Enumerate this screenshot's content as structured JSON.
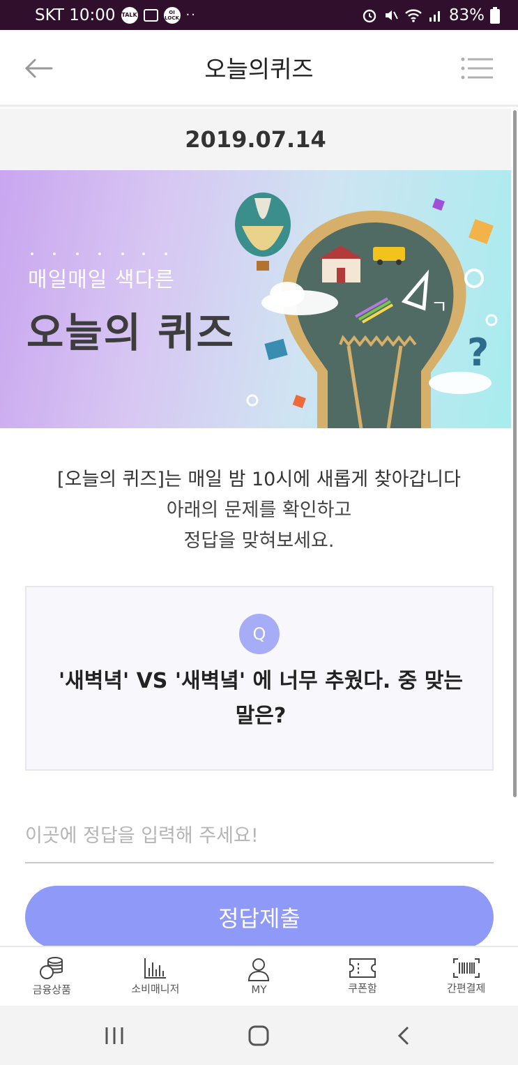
{
  "status_bar": {
    "carrier_time": "SKT 10:00",
    "talk_icon_text": "TALK",
    "lock_icon_text": "OI LOCK",
    "more": "··",
    "battery": "83%",
    "icons": [
      "kakaotalk-icon",
      "image-icon",
      "lock-icon",
      "alarm-icon",
      "mute-icon",
      "wifi-icon",
      "signal-icon",
      "battery-icon"
    ]
  },
  "app_bar": {
    "title": "오늘의퀴즈",
    "back_icon": "arrow-left-icon",
    "menu_icon": "menu-icon"
  },
  "date": "2019.07.14",
  "banner": {
    "subtitle": "매일매일 색다른",
    "title": "오늘의 퀴즈"
  },
  "intro": {
    "line1": "[오늘의 퀴즈]는 매일 밤 10시에 새롭게 찾아갑니다",
    "line2": "아래의 문제를 확인하고",
    "line3": "정답을 맞혀보세요."
  },
  "question": {
    "badge": "Q",
    "text": "'새벽녁' VS '새벽녘' 에 너무 추웠다. 중 맞는 말은?"
  },
  "answer_input": {
    "placeholder": "이곳에 정답을 입력해 주세요!",
    "value": ""
  },
  "submit_label": "정답제출",
  "bottom_nav": [
    {
      "label": "금융상품",
      "icon": "coins-icon"
    },
    {
      "label": "소비매니저",
      "icon": "bar-chart-icon"
    },
    {
      "label": "MY",
      "icon": "person-icon"
    },
    {
      "label": "쿠폰함",
      "icon": "ticket-icon"
    },
    {
      "label": "간편결제",
      "icon": "barcode-icon"
    }
  ],
  "system_nav": [
    "recent-apps-icon",
    "home-icon",
    "back-icon"
  ],
  "colors": {
    "status_bar": "#2f0f2c",
    "accent": "#8f9af8",
    "badge": "#a6acf6"
  }
}
